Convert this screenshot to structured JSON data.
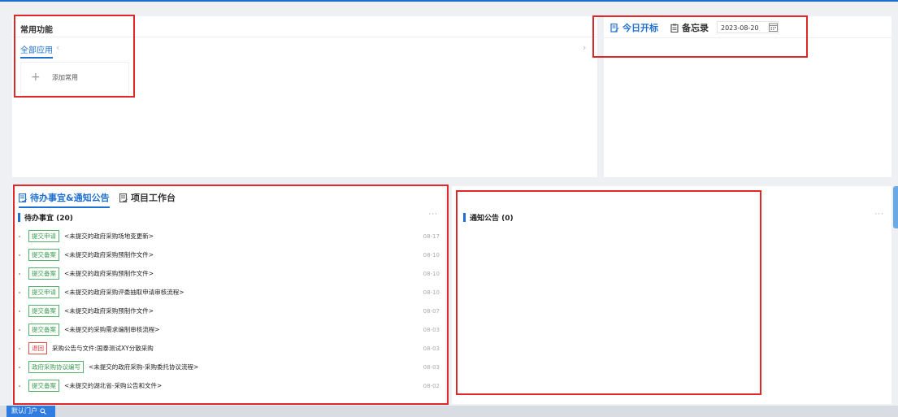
{
  "common": {
    "title": "常用功能",
    "tab_all": "全部应用",
    "add_label": "添加常用",
    "prev_glyph": "‹",
    "next_glyph": "›",
    "add_glyph": "+"
  },
  "bid": {
    "tab_today": "今日开标",
    "tab_memo": "备忘录",
    "date": "2023-08-20"
  },
  "todo": {
    "tab_todo_notice": "待办事宜&通知公告",
    "tab_workbench": "项目工作台",
    "heading": "待办事宜 (20)",
    "more": "···",
    "items": [
      {
        "tag": "提交申请",
        "tag_color": "green",
        "title": "<未提交的政府采购场地变更新>",
        "date": "08-17"
      },
      {
        "tag": "提交备案",
        "tag_color": "green",
        "title": "<未提交的政府采购预制作文件>",
        "date": "08-10"
      },
      {
        "tag": "提交备案",
        "tag_color": "green",
        "title": "<未提交的政府采购预制作文件>",
        "date": "08-10"
      },
      {
        "tag": "提交申请",
        "tag_color": "green",
        "title": "<未提交的政府采购评委抽取申请审核流程>",
        "date": "08-10"
      },
      {
        "tag": "提交备案",
        "tag_color": "green",
        "title": "<未提交的政府采购预制作文件>",
        "date": "08-07"
      },
      {
        "tag": "提交备案",
        "tag_color": "green",
        "title": "<未提交的采购需求编制审核流程>",
        "date": "08-03"
      },
      {
        "tag": "退回",
        "tag_color": "red",
        "title": "采购公告与文件:国泰测试XY分散采购",
        "date": "08-03"
      },
      {
        "tag": "政府采购协议编写",
        "tag_color": "green",
        "title": "<未提交的政府采购-采购委托协议流程>",
        "date": "08-03"
      },
      {
        "tag": "提交备案",
        "tag_color": "green",
        "title": "<未提交的湖北省-采购公告和文件>",
        "date": "08-02"
      }
    ]
  },
  "notice": {
    "heading": "通知公告 (0)",
    "more": "···"
  },
  "bottom": {
    "portal_label": "默认门户"
  },
  "colors": {
    "accent": "#1f6fd1",
    "highlight_box": "#e02828",
    "tag_green": "#3a9f52",
    "tag_red": "#e03b3b"
  }
}
